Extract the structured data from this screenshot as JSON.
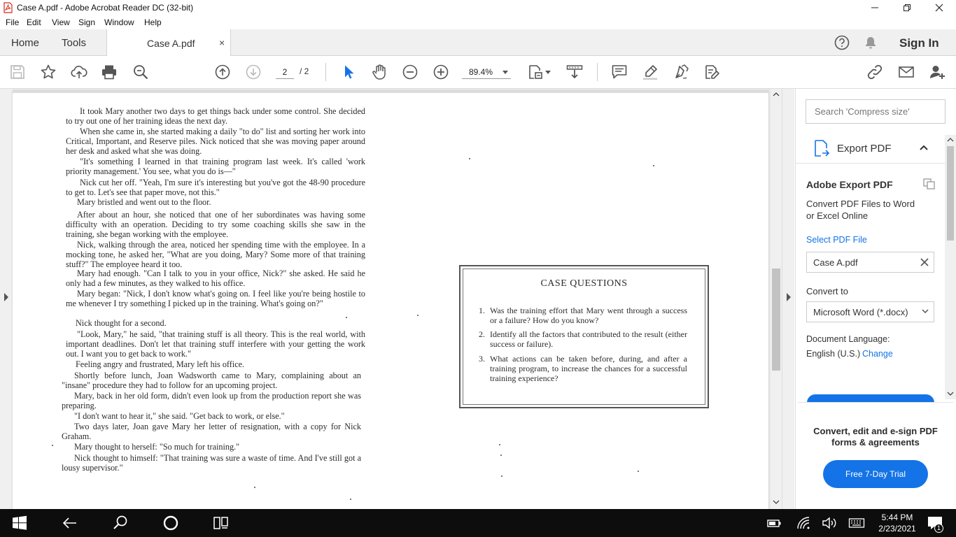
{
  "window": {
    "title": "Case A.pdf - Adobe Acrobat Reader DC (32-bit)"
  },
  "menu": [
    "File",
    "Edit",
    "View",
    "Sign",
    "Window",
    "Help"
  ],
  "tabs": {
    "home": "Home",
    "tools": "Tools",
    "document": "Case A.pdf",
    "close": "×",
    "sign_in": "Sign In"
  },
  "toolbar": {
    "page_current": "2",
    "page_total": "/ 2",
    "zoom": "89.4%"
  },
  "document": {
    "paragraphs": [
      "It took Mary another two days to get things back under some control. She decided to try out one of her training ideas the next day.",
      "When she came in, she started making a daily \"to do\" list and sorting her work into Critical, Important, and Reserve piles. Nick noticed that she was moving paper around her desk and asked what she was doing.",
      "\"It's something I learned in that training program last week. It's called 'work priority management.' You see, what you do is—\"",
      "Nick cut her off. \"Yeah, I'm sure it's interesting but you've got the 48-90 procedure to get to. Let's see that paper move, not this.\"",
      "Mary bristled and went out to the floor.",
      "After about an hour, she noticed that one of her subordinates was having some difficulty with an operation. Deciding to try some coaching skills she saw in the training, she began working with the employee.",
      "Nick, walking through the area, noticed her spending time with the employee. In a mocking tone, he asked her, \"What are you doing, Mary? Some more of that training stuff?\" The employee heard it too.",
      "Mary had enough. \"Can I talk to you in your office, Nick?\" she asked. He said he only had a few minutes, as they walked to his office.",
      "Mary began: \"Nick, I don't know what's going on. I feel like you're being hostile to me whenever I try something I picked up in the training. What's going on?\"",
      "Nick thought for a second.",
      "\"Look, Mary,\" he said, \"that training stuff is all theory. This is the real world, with important deadlines. Don't let that training stuff interfere with your getting the work out. I want you to get back to work.\"",
      "Feeling angry and frustrated, Mary left his office.",
      "Shortly before lunch, Joan Wadsworth came to Mary, complaining about an \"insane\" procedure they had to follow for an upcoming project.",
      "Mary, back in her old form, didn't even look up from the production report she was preparing.",
      "\"I don't want to hear it,\" she said. \"Get back to work, or else.\"",
      "Two days later, Joan gave Mary her letter of resignation, with a copy for Nick Graham.",
      "Mary thought to herself: \"So much for training.\"",
      "Nick thought to himself: \"That training was sure a waste of time. And I've still got a lousy supervisor.\""
    ],
    "case_questions": {
      "title": "CASE QUESTIONS",
      "items": [
        {
          "num": "1.",
          "text": "Was the training effort that Mary went through a success or a failure? How do you know?"
        },
        {
          "num": "2.",
          "text": "Identify all the factors that contributed to the result (either success or failure)."
        },
        {
          "num": "3.",
          "text": "What actions can be taken before, during, and after a training program, to increase the chances for a successful training experience?"
        }
      ]
    }
  },
  "right_panel": {
    "search_placeholder": "Search 'Compress size'",
    "tool_name": "Export PDF",
    "heading": "Adobe Export PDF",
    "description": "Convert PDF Files to Word or Excel Online",
    "select_link": "Select PDF File",
    "selected_file": "Case A.pdf",
    "convert_label": "Convert to",
    "convert_value": "Microsoft Word (*.docx)",
    "language_label": "Document Language:",
    "language_value": "English (U.S.)",
    "change_link": "Change",
    "promo_text": "Convert, edit and e-sign PDF forms & agreements",
    "promo_button": "Free 7-Day Trial"
  },
  "taskbar": {
    "time": "5:44 PM",
    "date": "2/23/2021",
    "notification_count": "1"
  },
  "colors": {
    "accent": "#1473e6",
    "taskbar": "#0d0d0d",
    "tool_icon": "#555555",
    "select_icon": "#1473e6"
  }
}
